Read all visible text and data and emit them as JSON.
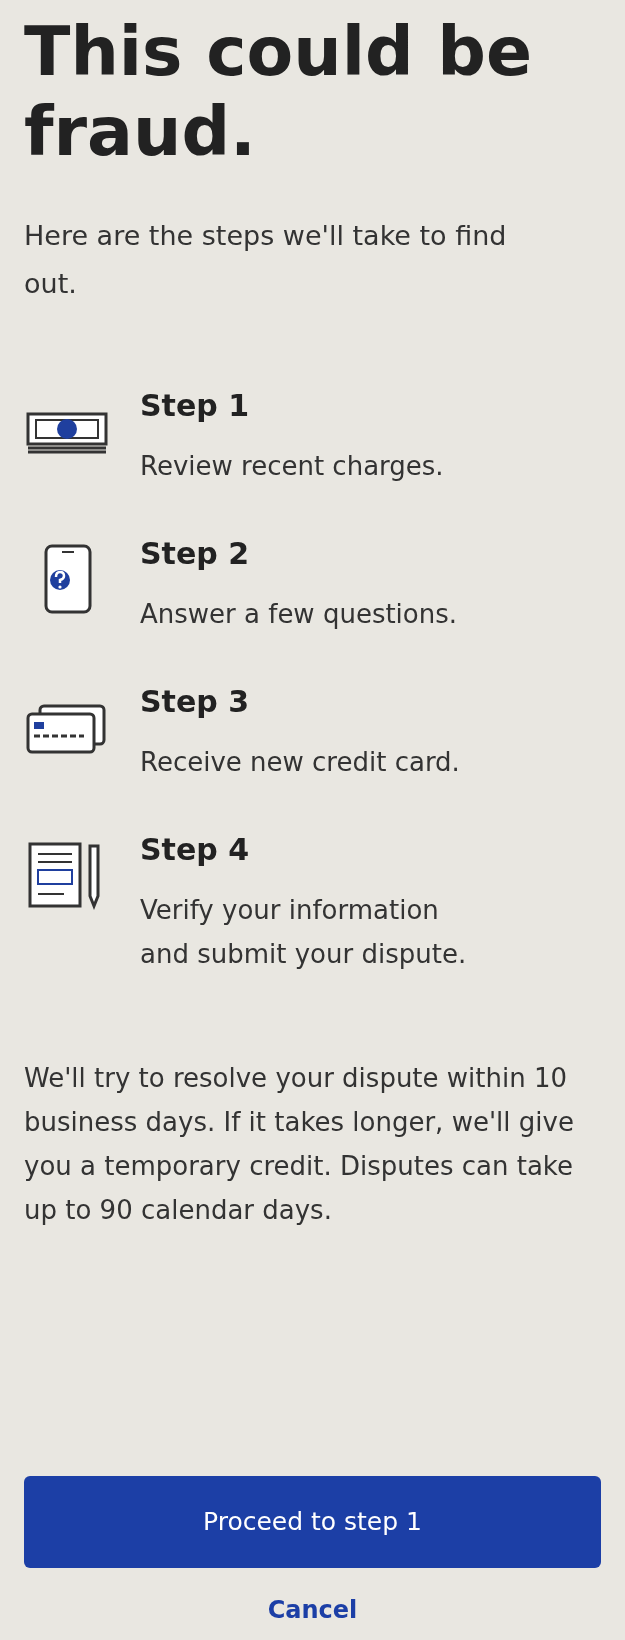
{
  "title": "This could be fraud.",
  "subtitle": "Here are the steps we'll take to find out.",
  "steps": [
    {
      "kind": "money",
      "label": "Step 1",
      "text": "Review recent charges."
    },
    {
      "kind": "phone",
      "label": "Step 2",
      "text": "Answer a few questions."
    },
    {
      "kind": "card",
      "label": "Step 3",
      "text": "Receive new credit card."
    },
    {
      "kind": "document",
      "label": "Step 4",
      "text": "Verify your information and submit your dispute."
    }
  ],
  "note": "We'll try to resolve your dispute within 10 business days. If it takes longer, we'll give you a temporary credit. Disputes can take up to 90 calendar days.",
  "primary_button": "Proceed to step 1",
  "cancel_link": "Cancel"
}
